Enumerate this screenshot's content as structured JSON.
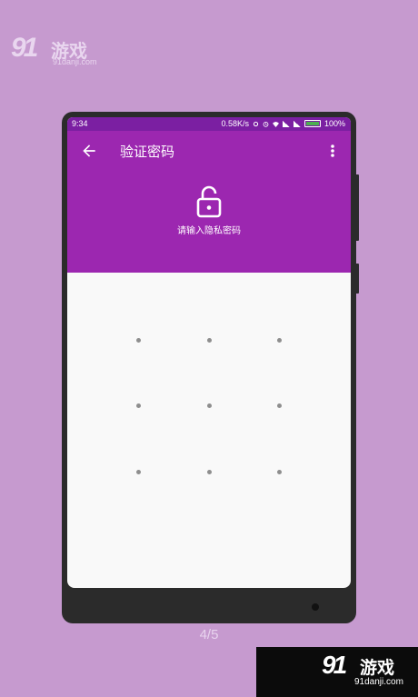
{
  "watermark": {
    "number": "91",
    "name": "游戏",
    "url": "91danji.com"
  },
  "status_bar": {
    "time": "9:34",
    "speed": "0.58K/s",
    "battery": "100%"
  },
  "app_bar": {
    "title": "验证密码",
    "prompt": "请输入隐私密码"
  },
  "pattern": {
    "rows": 3,
    "cols": 3
  },
  "page_indicator": "4/5",
  "colors": {
    "background": "#c69acf",
    "status_bar": "#7b1fa2",
    "app_bar": "#9c27b0",
    "screen": "#f9f9f9",
    "dot": "#8e8e8e"
  },
  "icons": [
    "back-arrow-icon",
    "more-vert-icon",
    "lock-open-icon",
    "alarm-icon",
    "wifi-icon",
    "signal-icon",
    "battery-icon"
  ]
}
